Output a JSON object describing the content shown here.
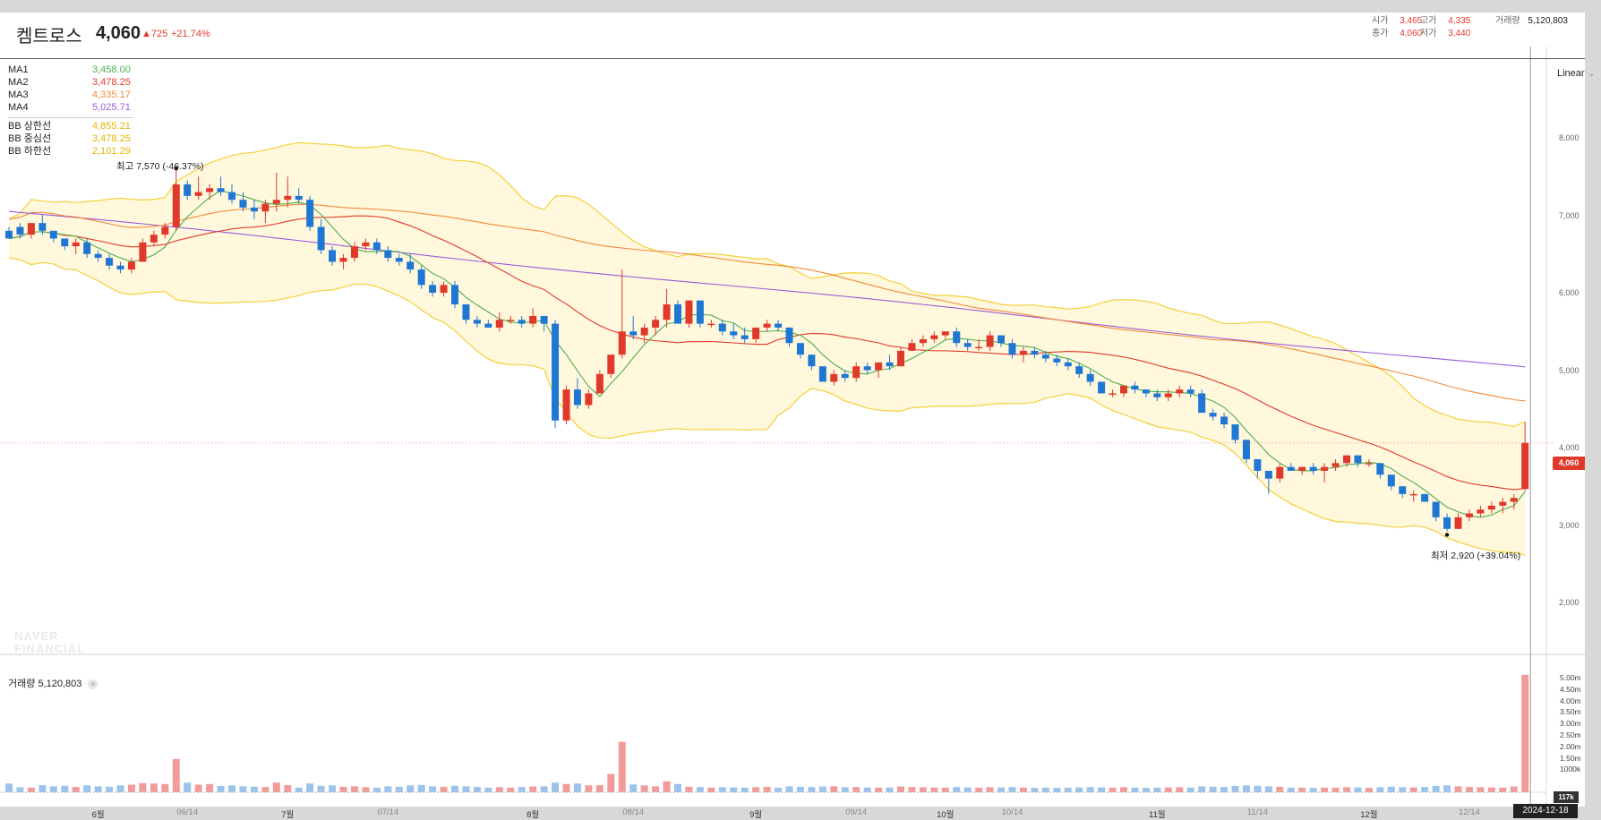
{
  "header": {
    "name": "켐트로스",
    "price": "4,060",
    "change": "▲725",
    "change_pct": "+21.74%",
    "ohlc": {
      "open_label": "시가",
      "open": "3,465",
      "high_label": "고가",
      "high": "4,335",
      "volume_label": "거래량",
      "volume": "5,120,803",
      "close_label": "종가",
      "close": "4,060",
      "low_label": "저가",
      "low": "3,440"
    }
  },
  "legend": {
    "ma": [
      {
        "label": "MA1",
        "value": "3,458.00",
        "color": "#4caf50"
      },
      {
        "label": "MA2",
        "value": "3,478.25",
        "color": "#e0392b"
      },
      {
        "label": "MA3",
        "value": "4,335.17",
        "color": "#f08a3a"
      },
      {
        "label": "MA4",
        "value": "5,025.71",
        "color": "#9b59d6"
      }
    ],
    "bb": [
      {
        "label": "BB 상한선",
        "value": "4,855.21",
        "color": "#e3b400"
      },
      {
        "label": "BB 중심선",
        "value": "3,478.25",
        "color": "#e3b400"
      },
      {
        "label": "BB 하한선",
        "value": "2,101.29",
        "color": "#e3b400"
      }
    ]
  },
  "scale_mode": "Linear",
  "volume_legend": {
    "label": "거래량",
    "value": "5,120,803"
  },
  "watermark": [
    "NAVER",
    "FINANCIAL"
  ],
  "price_tag": "4,060",
  "volume_tag": "117k",
  "date_tag": "2024-12-18",
  "annotations": {
    "high": "최고 7,570 (-46.37%)",
    "low": "최저 2,920 (+39.04%)"
  },
  "colors": {
    "up": "#e0392b",
    "down": "#1f77d4",
    "ma1": "#4caf50",
    "ma2": "#e0392b",
    "ma3": "#f08a3a",
    "ma4": "#9b59d6",
    "bb": "#f3d03a",
    "bb_fill": "#fff8dc"
  },
  "chart_data": {
    "type": "candlestick",
    "title": "켐트로스",
    "price_axis": {
      "ticks": [
        2000,
        3000,
        4000,
        5000,
        6000,
        7000,
        8000
      ],
      "tick_labels": [
        "2,000",
        "3,000",
        "4,000",
        "5,000",
        "6,000",
        "7,000",
        "8,000"
      ],
      "scale": "linear"
    },
    "volume_axis": {
      "ticks": [
        1000000,
        1500000,
        2000000,
        2500000,
        3000000,
        3500000,
        4000000,
        4500000,
        5000000
      ],
      "tick_labels": [
        "1000k",
        "1.50m",
        "2.00m",
        "2.50m",
        "3.00m",
        "3.50m",
        "4.00m",
        "4.50m",
        "5.00m"
      ]
    },
    "x_ticks": [
      {
        "label": "6월",
        "index": 8,
        "major": true
      },
      {
        "label": "06/14",
        "index": 16,
        "major": false
      },
      {
        "label": "7월",
        "index": 25,
        "major": true
      },
      {
        "label": "07/14",
        "index": 34,
        "major": false
      },
      {
        "label": "8월",
        "index": 47,
        "major": true
      },
      {
        "label": "08/14",
        "index": 56,
        "major": false
      },
      {
        "label": "9월",
        "index": 67,
        "major": true
      },
      {
        "label": "09/14",
        "index": 76,
        "major": false
      },
      {
        "label": "10월",
        "index": 84,
        "major": true
      },
      {
        "label": "10/14",
        "index": 90,
        "major": false
      },
      {
        "label": "11월",
        "index": 103,
        "major": true
      },
      {
        "label": "11/14",
        "index": 112,
        "major": false
      },
      {
        "label": "12월",
        "index": 122,
        "major": true
      },
      {
        "label": "12/14",
        "index": 131,
        "major": false
      }
    ],
    "candles": [
      [
        6800,
        6850,
        6750,
        6700,
        380000
      ],
      [
        6850,
        6900,
        6700,
        6750,
        220000
      ],
      [
        6750,
        6900,
        6700,
        6900,
        200000
      ],
      [
        6900,
        7000,
        6750,
        6800,
        310000
      ],
      [
        6800,
        6800,
        6650,
        6700,
        260000
      ],
      [
        6700,
        6700,
        6550,
        6600,
        280000
      ],
      [
        6600,
        6700,
        6500,
        6650,
        230000
      ],
      [
        6650,
        6700,
        6450,
        6500,
        300000
      ],
      [
        6500,
        6550,
        6400,
        6450,
        260000
      ],
      [
        6450,
        6500,
        6300,
        6350,
        240000
      ],
      [
        6350,
        6400,
        6250,
        6300,
        300000
      ],
      [
        6300,
        6450,
        6250,
        6400,
        330000
      ],
      [
        6400,
        6700,
        6400,
        6650,
        400000
      ],
      [
        6650,
        6800,
        6600,
        6750,
        380000
      ],
      [
        6750,
        6900,
        6700,
        6850,
        360000
      ],
      [
        6850,
        7600,
        6800,
        7400,
        1450000
      ],
      [
        7400,
        7450,
        7200,
        7250,
        420000
      ],
      [
        7250,
        7500,
        7200,
        7300,
        330000
      ],
      [
        7300,
        7400,
        7200,
        7350,
        360000
      ],
      [
        7350,
        7500,
        7250,
        7300,
        280000
      ],
      [
        7300,
        7400,
        7150,
        7200,
        300000
      ],
      [
        7200,
        7300,
        7050,
        7100,
        260000
      ],
      [
        7100,
        7200,
        6950,
        7050,
        240000
      ],
      [
        7050,
        7200,
        6900,
        7150,
        230000
      ],
      [
        7150,
        7550,
        7050,
        7200,
        420000
      ],
      [
        7200,
        7500,
        7100,
        7250,
        310000
      ],
      [
        7250,
        7350,
        7150,
        7200,
        200000
      ],
      [
        7200,
        7250,
        6800,
        6850,
        380000
      ],
      [
        6850,
        6950,
        6500,
        6550,
        280000
      ],
      [
        6550,
        6600,
        6350,
        6400,
        300000
      ],
      [
        6400,
        6500,
        6300,
        6450,
        240000
      ],
      [
        6450,
        6650,
        6400,
        6600,
        260000
      ],
      [
        6600,
        6700,
        6550,
        6650,
        220000
      ],
      [
        6650,
        6700,
        6500,
        6550,
        200000
      ],
      [
        6550,
        6600,
        6400,
        6450,
        260000
      ],
      [
        6450,
        6500,
        6350,
        6400,
        240000
      ],
      [
        6400,
        6500,
        6250,
        6300,
        300000
      ],
      [
        6300,
        6350,
        6050,
        6100,
        320000
      ],
      [
        6100,
        6150,
        5950,
        6000,
        260000
      ],
      [
        6000,
        6150,
        5950,
        6100,
        240000
      ],
      [
        6100,
        6150,
        5800,
        5850,
        280000
      ],
      [
        5850,
        5850,
        5600,
        5650,
        260000
      ],
      [
        5650,
        5700,
        5550,
        5600,
        230000
      ],
      [
        5600,
        5650,
        5550,
        5550,
        200000
      ],
      [
        5550,
        5750,
        5500,
        5650,
        220000
      ],
      [
        5650,
        5700,
        5600,
        5650,
        200000
      ],
      [
        5650,
        5700,
        5550,
        5600,
        230000
      ],
      [
        5600,
        5800,
        5550,
        5700,
        250000
      ],
      [
        5700,
        5700,
        5500,
        5600,
        260000
      ],
      [
        5600,
        5650,
        4250,
        4350,
        420000
      ],
      [
        4350,
        4800,
        4300,
        4750,
        360000
      ],
      [
        4750,
        4900,
        4500,
        4550,
        380000
      ],
      [
        4550,
        4750,
        4500,
        4700,
        300000
      ],
      [
        4700,
        5000,
        4700,
        4950,
        310000
      ],
      [
        4950,
        5200,
        4900,
        5200,
        800000
      ],
      [
        5200,
        6300,
        5150,
        5500,
        2200000
      ],
      [
        5500,
        5700,
        5400,
        5450,
        340000
      ],
      [
        5450,
        5600,
        5350,
        5550,
        300000
      ],
      [
        5550,
        5700,
        5450,
        5650,
        260000
      ],
      [
        5650,
        6050,
        5550,
        5850,
        480000
      ],
      [
        5850,
        5900,
        5600,
        5600,
        360000
      ],
      [
        5600,
        5900,
        5550,
        5900,
        240000
      ],
      [
        5900,
        5900,
        5550,
        5600,
        230000
      ],
      [
        5600,
        5650,
        5550,
        5600,
        200000
      ],
      [
        5600,
        5650,
        5450,
        5500,
        220000
      ],
      [
        5500,
        5600,
        5400,
        5450,
        210000
      ],
      [
        5450,
        5550,
        5350,
        5400,
        200000
      ],
      [
        5400,
        5550,
        5350,
        5550,
        220000
      ],
      [
        5550,
        5650,
        5500,
        5600,
        240000
      ],
      [
        5600,
        5650,
        5500,
        5550,
        200000
      ],
      [
        5550,
        5550,
        5300,
        5350,
        260000
      ],
      [
        5350,
        5350,
        5150,
        5200,
        240000
      ],
      [
        5200,
        5200,
        5000,
        5050,
        230000
      ],
      [
        5050,
        5050,
        4850,
        4850,
        250000
      ],
      [
        4850,
        5000,
        4800,
        4950,
        260000
      ],
      [
        4950,
        5000,
        4850,
        4900,
        220000
      ],
      [
        4900,
        5100,
        4850,
        5050,
        230000
      ],
      [
        5050,
        5100,
        4950,
        5000,
        210000
      ],
      [
        5000,
        5100,
        4900,
        5100,
        200000
      ],
      [
        5100,
        5200,
        5000,
        5050,
        210000
      ],
      [
        5050,
        5300,
        5050,
        5250,
        250000
      ],
      [
        5250,
        5400,
        5250,
        5350,
        230000
      ],
      [
        5350,
        5450,
        5300,
        5400,
        220000
      ],
      [
        5400,
        5500,
        5350,
        5450,
        210000
      ],
      [
        5450,
        5500,
        5400,
        5500,
        200000
      ],
      [
        5500,
        5550,
        5300,
        5350,
        230000
      ],
      [
        5350,
        5400,
        5250,
        5300,
        210000
      ],
      [
        5300,
        5400,
        5250,
        5300,
        200000
      ],
      [
        5300,
        5500,
        5250,
        5450,
        220000
      ],
      [
        5450,
        5450,
        5300,
        5350,
        210000
      ],
      [
        5350,
        5400,
        5150,
        5200,
        230000
      ],
      [
        5200,
        5300,
        5100,
        5250,
        200000
      ],
      [
        5250,
        5300,
        5150,
        5200,
        190000
      ],
      [
        5200,
        5250,
        5100,
        5150,
        200000
      ],
      [
        5150,
        5200,
        5050,
        5100,
        190000
      ],
      [
        5100,
        5150,
        5000,
        5050,
        200000
      ],
      [
        5050,
        5100,
        4900,
        4950,
        210000
      ],
      [
        4950,
        5000,
        4800,
        4850,
        230000
      ],
      [
        4850,
        4850,
        4700,
        4700,
        210000
      ],
      [
        4700,
        4750,
        4650,
        4700,
        200000
      ],
      [
        4700,
        4800,
        4650,
        4800,
        220000
      ],
      [
        4800,
        4850,
        4700,
        4750,
        200000
      ],
      [
        4750,
        4750,
        4650,
        4700,
        190000
      ],
      [
        4700,
        4750,
        4600,
        4650,
        200000
      ],
      [
        4650,
        4750,
        4600,
        4700,
        210000
      ],
      [
        4700,
        4800,
        4650,
        4750,
        220000
      ],
      [
        4750,
        4800,
        4650,
        4700,
        200000
      ],
      [
        4700,
        4750,
        4450,
        4450,
        260000
      ],
      [
        4450,
        4500,
        4350,
        4400,
        240000
      ],
      [
        4400,
        4450,
        4250,
        4300,
        230000
      ],
      [
        4300,
        4300,
        4050,
        4100,
        280000
      ],
      [
        4100,
        4100,
        3800,
        3850,
        300000
      ],
      [
        3850,
        3850,
        3600,
        3700,
        280000
      ],
      [
        3700,
        3700,
        3400,
        3600,
        260000
      ],
      [
        3600,
        3800,
        3550,
        3750,
        240000
      ],
      [
        3750,
        3800,
        3700,
        3700,
        200000
      ],
      [
        3700,
        3750,
        3650,
        3750,
        200000
      ],
      [
        3750,
        3800,
        3650,
        3700,
        190000
      ],
      [
        3700,
        3800,
        3550,
        3750,
        200000
      ],
      [
        3750,
        3850,
        3700,
        3800,
        200000
      ],
      [
        3800,
        3900,
        3750,
        3900,
        220000
      ],
      [
        3900,
        3900,
        3750,
        3800,
        210000
      ],
      [
        3800,
        3850,
        3750,
        3800,
        190000
      ],
      [
        3800,
        3800,
        3600,
        3650,
        220000
      ],
      [
        3650,
        3650,
        3450,
        3500,
        240000
      ],
      [
        3500,
        3500,
        3350,
        3400,
        220000
      ],
      [
        3400,
        3450,
        3300,
        3400,
        210000
      ],
      [
        3400,
        3400,
        3300,
        3300,
        230000
      ],
      [
        3300,
        3300,
        3050,
        3100,
        280000
      ],
      [
        3100,
        3150,
        2920,
        2950,
        300000
      ],
      [
        2950,
        3150,
        2950,
        3100,
        260000
      ],
      [
        3100,
        3200,
        3050,
        3150,
        230000
      ],
      [
        3150,
        3250,
        3100,
        3200,
        220000
      ],
      [
        3200,
        3300,
        3150,
        3250,
        210000
      ],
      [
        3250,
        3350,
        3150,
        3300,
        200000
      ],
      [
        3300,
        3400,
        3200,
        3350,
        250000
      ],
      [
        3465,
        4335,
        3440,
        4060,
        5120803
      ]
    ],
    "ma1_last": 3458.0,
    "ma2_last": 3478.25,
    "ma3_last": 4335.17,
    "ma4_last": 5025.71,
    "bb_upper_last": 4855.21,
    "bb_lower_last": 2101.29,
    "high_point": {
      "index": 15,
      "price": 7570
    },
    "low_point": {
      "index": 129,
      "price": 2920
    }
  }
}
